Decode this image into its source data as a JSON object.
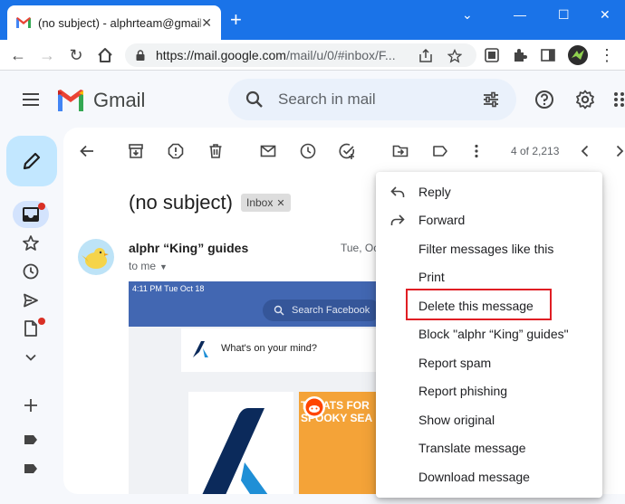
{
  "browser": {
    "tab_title": "(no subject) - alphrteam@gmail.com",
    "url_host": "https://mail.google.com",
    "url_path": "/mail/u/0/#inbox/F..."
  },
  "gmail": {
    "wordmark": "Gmail",
    "search_placeholder": "Search in mail"
  },
  "thread": {
    "subject": "(no subject)",
    "label": "Inbox",
    "pager": "4 of 2,213",
    "sender": "alphr “King” guides",
    "date": "Tue, Oct",
    "recipient": "to me"
  },
  "embed": {
    "status_time": "4:11 PM  Tue Oct 18",
    "search_placeholder": "Search Facebook",
    "composer_prompt": "What's on your mind?",
    "post_text": "TREATS FOR SPOOKY SEA"
  },
  "menu": {
    "items": [
      {
        "label": "Reply",
        "icon": "reply-icon"
      },
      {
        "label": "Forward",
        "icon": "forward-icon"
      },
      {
        "label": "Filter messages like this"
      },
      {
        "label": "Print"
      },
      {
        "label": "Delete this message"
      },
      {
        "label": "Block \"alphr “King” guides\""
      },
      {
        "label": "Report spam"
      },
      {
        "label": "Report phishing"
      },
      {
        "label": "Show original"
      },
      {
        "label": "Translate message"
      },
      {
        "label": "Download message"
      }
    ]
  },
  "colors": {
    "chrome_blue": "#1a73e8",
    "compose_bg": "#c2e7ff",
    "search_bg": "#eaf1fb",
    "highlight_red": "#e01e24",
    "facebook_blue": "#4267b2"
  }
}
